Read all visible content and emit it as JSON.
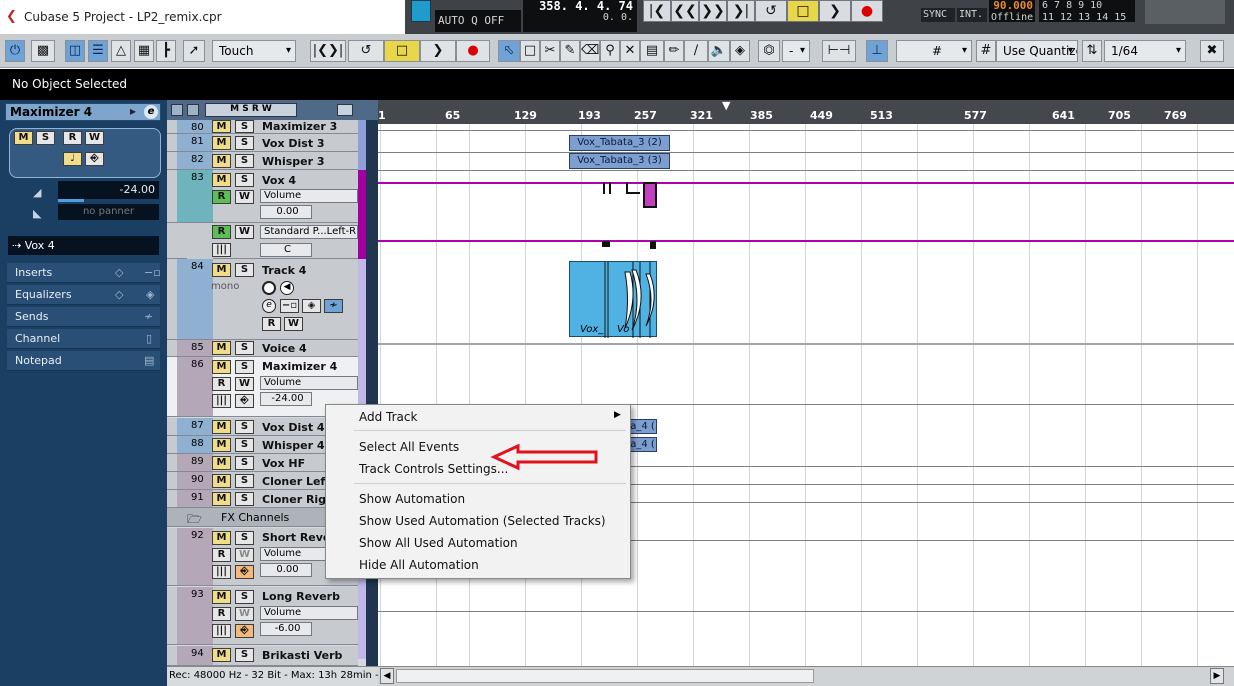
{
  "window": {
    "title": "Cubase 5 Project - LP2_remix.cpr"
  },
  "transport": {
    "auto_q": "AUTO Q",
    "auto_q_state": "OFF",
    "position": "358. 4. 4. 74",
    "position_sub": "0.  0.",
    "sync_label": "SYNC",
    "int_label": "INT.",
    "tempo": "90.000",
    "tempo_status": "Offline",
    "markers_top": "6  7  8  9  10",
    "markers_bottom": "11 12 13 14 15"
  },
  "toolbar": {
    "automation_mode": "Touch",
    "quantize_label": "Use Quantize",
    "quantize_value": "1/64",
    "dash_value": "-"
  },
  "info_line": {
    "text": "No Object Selected"
  },
  "inspector": {
    "track_name": "Maximizer 4",
    "volume_value": "-24.00",
    "panner_text": "no panner",
    "output": "Vox 4",
    "sections": [
      "Inserts",
      "Equalizers",
      "Sends",
      "Channel",
      "Notepad"
    ]
  },
  "tracks": {
    "t80": {
      "num": "80",
      "name": "Maximizer 3"
    },
    "t81": {
      "num": "81",
      "name": "Vox Dist 3"
    },
    "t82": {
      "num": "82",
      "name": "Whisper 3"
    },
    "t83": {
      "num": "83",
      "name": "Vox 4",
      "param": "Volume",
      "value": "0.00"
    },
    "t83b": {
      "param": "Standard P...Left-R",
      "value": "C"
    },
    "t84": {
      "num": "84",
      "name": "Track 4",
      "mode": "mono"
    },
    "t85": {
      "num": "85",
      "name": "Voice 4"
    },
    "t86": {
      "num": "86",
      "name": "Maximizer 4",
      "param": "Volume",
      "value": "-24.00"
    },
    "t87": {
      "num": "87",
      "name": "Vox Dist 4"
    },
    "t88": {
      "num": "88",
      "name": "Whisper 4"
    },
    "t89": {
      "num": "89",
      "name": "Vox HF"
    },
    "t90": {
      "num": "90",
      "name": "Cloner Left"
    },
    "t91": {
      "num": "91",
      "name": "Cloner Right"
    },
    "fx_folder": {
      "name": "FX Channels"
    },
    "t92": {
      "num": "92",
      "name": "Short Reverb",
      "param": "Volume",
      "value": "0.00"
    },
    "t93": {
      "num": "93",
      "name": "Long Reverb",
      "param": "Volume",
      "value": "-6.00"
    },
    "t94": {
      "num": "94",
      "name": "Brikasti Verb"
    }
  },
  "ruler": {
    "ticks": [
      "1",
      "65",
      "129",
      "193",
      "257",
      "321",
      "385",
      "449",
      "513",
      "577",
      "641",
      "705",
      "769"
    ]
  },
  "events": {
    "e1": "Vox_Tabata_3 (2)",
    "e2": "Vox_Tabata_3 (3)",
    "e3": "Vox_",
    "e4": "Vo",
    "e5": "ata_4 (",
    "e6": "ata_4 ("
  },
  "status": {
    "text": "Rec: 48000 Hz - 32 Bit - Max: 13h 28min - 3"
  },
  "context_menu": {
    "items": [
      "Add Track",
      "Select All Events",
      "Track Controls Settings...",
      "Show Automation",
      "Show Used Automation (Selected Tracks)",
      "Show All Used Automation",
      "Hide All Automation"
    ]
  },
  "colors": {
    "automation": "#b000b0",
    "event": "#7d9ed1",
    "audio_event": "#4fb2e3",
    "arrow": "#e0121b"
  }
}
